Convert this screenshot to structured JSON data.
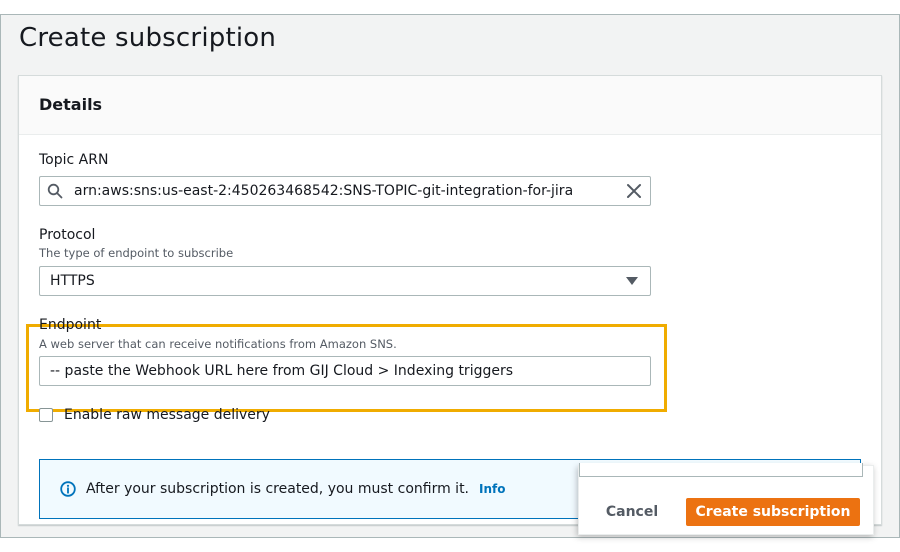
{
  "page": {
    "title": "Create subscription"
  },
  "details": {
    "header": "Details",
    "topic_arn": {
      "label": "Topic ARN",
      "value": "arn:aws:sns:us-east-2:450263468542:SNS-TOPIC-git-integration-for-jira"
    },
    "protocol": {
      "label": "Protocol",
      "description": "The type of endpoint to subscribe",
      "value": "HTTPS"
    },
    "endpoint": {
      "label": "Endpoint",
      "description": "A web server that can receive notifications from Amazon SNS.",
      "value": "-- paste the Webhook URL here from GIJ Cloud > Indexing triggers"
    },
    "raw_delivery": {
      "label": "Enable raw message delivery",
      "checked": false
    }
  },
  "alert": {
    "text": "After your subscription is created, you must confirm it.",
    "link": "Info"
  },
  "actions": {
    "cancel": "Cancel",
    "create": "Create subscription"
  },
  "colors": {
    "primary_button": "#ec7211",
    "highlight_border": "#f0ac00",
    "info_blue": "#0073bb"
  }
}
